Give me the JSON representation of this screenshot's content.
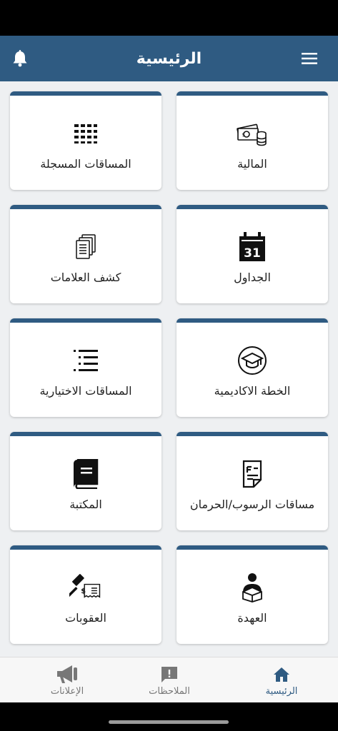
{
  "header": {
    "title": "الرئيسية",
    "menu_icon": "hamburger-menu-icon",
    "notification_icon": "bell-icon",
    "color": "#2f5b82"
  },
  "cards": [
    {
      "label": "المالية",
      "icon": "money-icon"
    },
    {
      "label": "المساقات المسجلة",
      "icon": "grid-dots-icon"
    },
    {
      "label": "الجداول",
      "icon": "calendar-31-icon"
    },
    {
      "label": "كشف العلامات",
      "icon": "documents-icon"
    },
    {
      "label": "الخطة الاكاديمية",
      "icon": "graduation-cap-icon"
    },
    {
      "label": "المساقات الاختيارية",
      "icon": "list-icon"
    },
    {
      "label": "مساقات الرسوب/الحرمان",
      "icon": "form-document-icon"
    },
    {
      "label": "المكتبة",
      "icon": "book-icon"
    },
    {
      "label": "العهدة",
      "icon": "person-box-icon"
    },
    {
      "label": "العقوبات",
      "icon": "gavel-fine-icon"
    }
  ],
  "calendar_day": "31",
  "bottom_nav": [
    {
      "label": "الرئيسية",
      "icon": "home-icon",
      "active": true
    },
    {
      "label": "الملاحظات",
      "icon": "feedback-icon",
      "active": false
    },
    {
      "label": "الإعلانات",
      "icon": "megaphone-icon",
      "active": false
    }
  ],
  "colors": {
    "primary": "#2f5b82",
    "background": "#eef0f2",
    "inactive": "#777777"
  }
}
